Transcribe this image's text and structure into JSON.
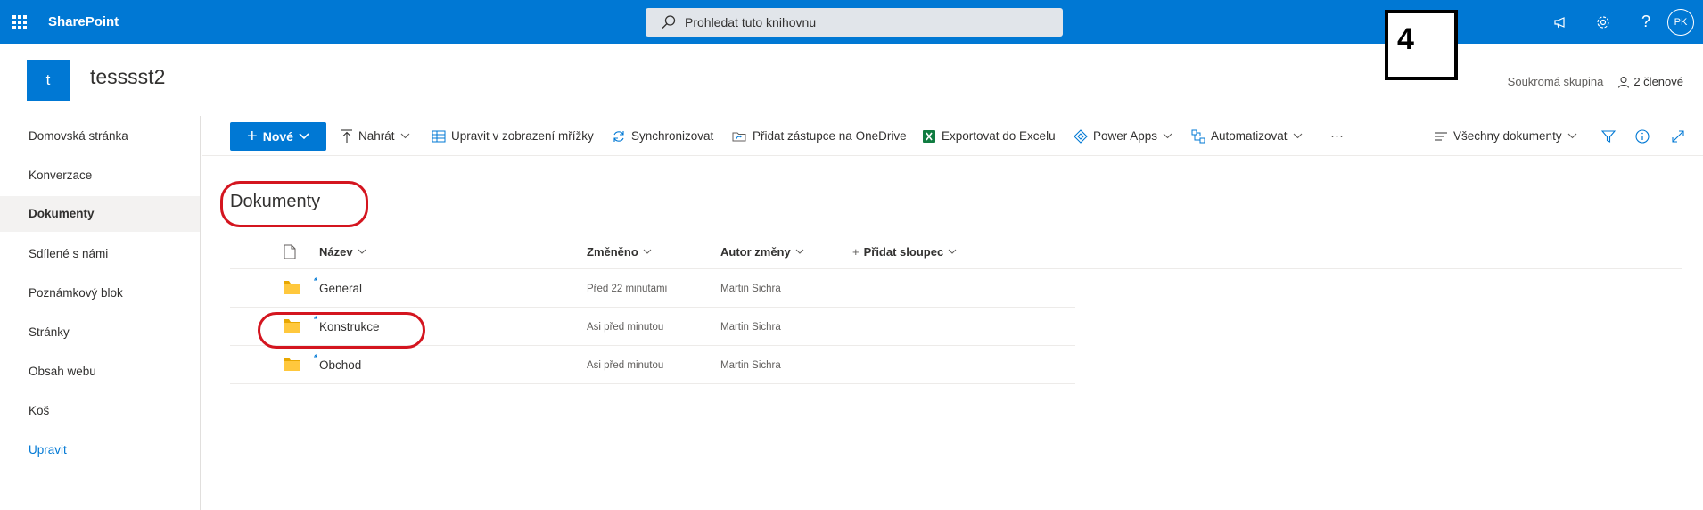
{
  "suite": {
    "brand": "SharePoint",
    "search_placeholder": "Prohledat tuto knihovnu",
    "avatar_initials": "PK"
  },
  "annotation": {
    "step_number": "4"
  },
  "site": {
    "logo_letter": "t",
    "title": "tesssst2",
    "privacy": "Soukromá skupina",
    "members": "2 členové"
  },
  "leftnav": {
    "items": [
      {
        "label": "Domovská stránka"
      },
      {
        "label": "Konverzace"
      },
      {
        "label": "Dokumenty"
      },
      {
        "label": "Sdílené s námi"
      },
      {
        "label": "Poznámkový blok"
      },
      {
        "label": "Stránky"
      },
      {
        "label": "Obsah webu"
      },
      {
        "label": "Koš"
      }
    ],
    "edit_label": "Upravit"
  },
  "commandbar": {
    "new_label": "Nové",
    "upload_label": "Nahrát",
    "grid_edit_label": "Upravit v zobrazení mřížky",
    "sync_label": "Synchronizovat",
    "onedrive_label": "Přidat zástupce na OneDrive",
    "excel_label": "Exportovat do Excelu",
    "powerapps_label": "Power Apps",
    "automate_label": "Automatizovat",
    "more_label": "···",
    "view_label": "Všechny dokumenty"
  },
  "library": {
    "title": "Dokumenty",
    "columns": {
      "name": "Název",
      "modified": "Změněno",
      "modified_by": "Autor změny",
      "add_column": "Přidat sloupec"
    },
    "rows": [
      {
        "name": "General",
        "modified": "Před 22 minutami",
        "modified_by": "Martin Sichra"
      },
      {
        "name": "Konstrukce",
        "modified": "Asi před minutou",
        "modified_by": "Martin Sichra"
      },
      {
        "name": "Obchod",
        "modified": "Asi před minutou",
        "modified_by": "Martin Sichra"
      }
    ]
  },
  "colors": {
    "suite_bar": "#0078d4",
    "annotation_red": "#d4151f",
    "folder_yellow": "#ffc83d"
  }
}
